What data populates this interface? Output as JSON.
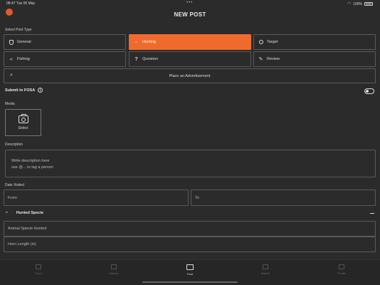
{
  "status_bar": {
    "time": "08:47",
    "date": "Tue 06 May",
    "battery": "100%"
  },
  "header": {
    "title": "NEW POST"
  },
  "post_type": {
    "label": "Select Post Type",
    "options": [
      {
        "label": "General",
        "icon": "shield-icon",
        "active": false
      },
      {
        "label": "Hunting",
        "icon": "horns-icon",
        "active": true
      },
      {
        "label": "Target",
        "icon": "crosshair-icon",
        "active": false
      },
      {
        "label": "Fishing",
        "icon": "fish-icon",
        "active": false
      },
      {
        "label": "Question",
        "icon": "question-icon",
        "active": false
      },
      {
        "label": "Review",
        "icon": "pencil-icon",
        "active": false
      }
    ],
    "advertisement": "Place an Advertisement"
  },
  "fosa": {
    "label": "Submit to FOSA",
    "enabled": false
  },
  "media": {
    "label": "Media",
    "select_label": "Select"
  },
  "description": {
    "label": "Description",
    "placeholder_line1": "Write description here",
    "placeholder_line2": "use @... to tag a person"
  },
  "date_visited": {
    "label": "Date Visited",
    "from_placeholder": "From",
    "to_placeholder": "To"
  },
  "hunted_specie": {
    "label": "Hunted Specie",
    "animal_placeholder": "Animal Specie Hunted",
    "horn_placeholder": "Horn Length (in)"
  },
  "tabbar": {
    "items": [
      {
        "label": "Feed",
        "active": false
      },
      {
        "label": "Classes",
        "active": false
      },
      {
        "label": "Post",
        "active": true
      },
      {
        "label": "Market",
        "active": false
      },
      {
        "label": "Profile",
        "active": false
      }
    ]
  },
  "colors": {
    "accent": "#f06a2e",
    "background": "#2b2b2b"
  }
}
